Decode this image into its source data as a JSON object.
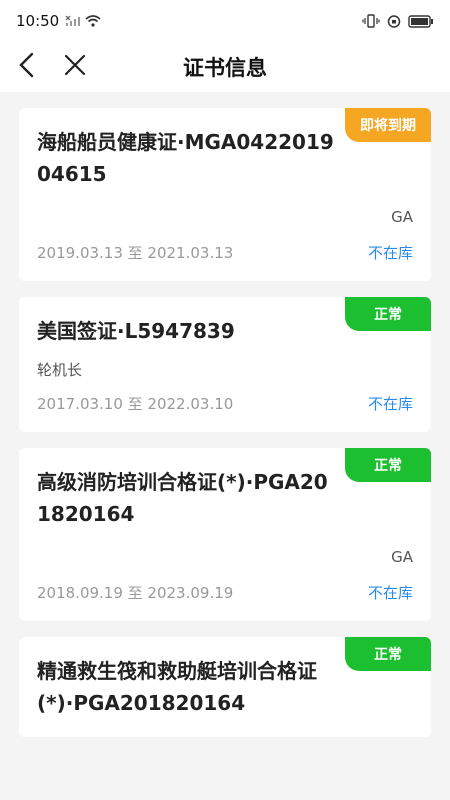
{
  "status": {
    "time": "10:50"
  },
  "header": {
    "title": "证书信息"
  },
  "cards": [
    {
      "title": "海船船员健康证·MGA042201904615",
      "badge": "即将到期",
      "badge_color": "#f5a623",
      "org": "GA",
      "dates": "2019.03.13 至 2021.03.13",
      "store": "不在库"
    },
    {
      "title": "美国签证·L5947839",
      "badge": "正常",
      "badge_color": "#1bbf2f",
      "role": "轮机长",
      "dates": "2017.03.10 至 2022.03.10",
      "store": "不在库"
    },
    {
      "title": "高级消防培训合格证(*)·PGA201820164",
      "badge": "正常",
      "badge_color": "#1bbf2f",
      "org": "GA",
      "dates": "2018.09.19 至 2023.09.19",
      "store": "不在库"
    },
    {
      "title": "精通救生筏和救助艇培训合格证(*)·PGA201820164",
      "badge": "正常",
      "badge_color": "#1bbf2f"
    }
  ]
}
